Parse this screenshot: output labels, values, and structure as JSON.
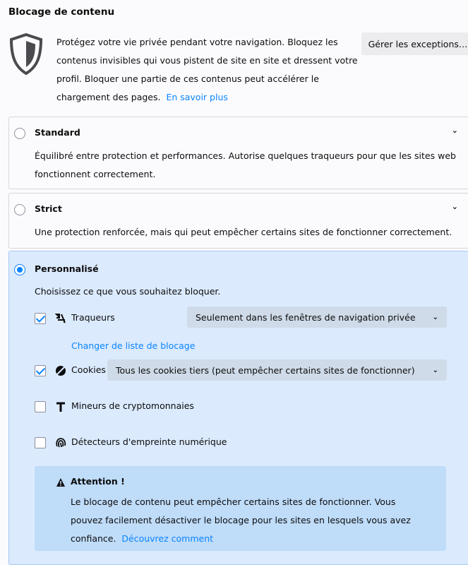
{
  "page": {
    "title": "Blocage de contenu",
    "intro": "Protégez votre vie privée pendant votre navigation. Bloquez les contenus invisibles qui vous pistent de site en site et dressent votre profil. Bloquer une partie de ces contenus peut accélérer le chargement des pages.",
    "learn_more": "En savoir plus",
    "manage_exceptions": "Gérer les exceptions…",
    "accent_color": "#0a84ff"
  },
  "standard": {
    "title": "Standard",
    "description": "Équilibré entre protection et performances. Autorise quelques traqueurs pour que les sites web fonctionnent correctement.",
    "selected": false
  },
  "strict": {
    "title": "Strict",
    "description": "Une protection renforcée, mais qui peut empêcher certains sites de fonctionner correctement.",
    "selected": false
  },
  "custom": {
    "title": "Personnalisé",
    "selected": true,
    "description": "Choisissez ce que vous souhaitez bloquer.",
    "trackers": {
      "label": "Traqueurs",
      "checked": true,
      "icon": "tracker-icon",
      "dropdown_value": "Seulement dans les fenêtres de navigation privée",
      "change_list": "Changer de liste de blocage"
    },
    "cookies": {
      "label": "Cookies",
      "checked": true,
      "icon": "cookie-icon",
      "dropdown_value": "Tous les cookies tiers (peut empêcher certains sites de fonctionner)"
    },
    "cryptominers": {
      "label": "Mineurs de cryptomonnaies",
      "checked": false,
      "icon": "cryptominer-icon"
    },
    "fingerprinters": {
      "label": "Détecteurs d'empreinte numérique",
      "checked": false,
      "icon": "fingerprint-icon"
    },
    "warning": {
      "title": "Attention !",
      "text": "Le blocage de contenu peut empêcher certains sites de fonctionner. Vous pouvez facilement désactiver le blocage pour les sites en lesquels vous avez confiance.",
      "link": "Découvrez comment"
    }
  }
}
